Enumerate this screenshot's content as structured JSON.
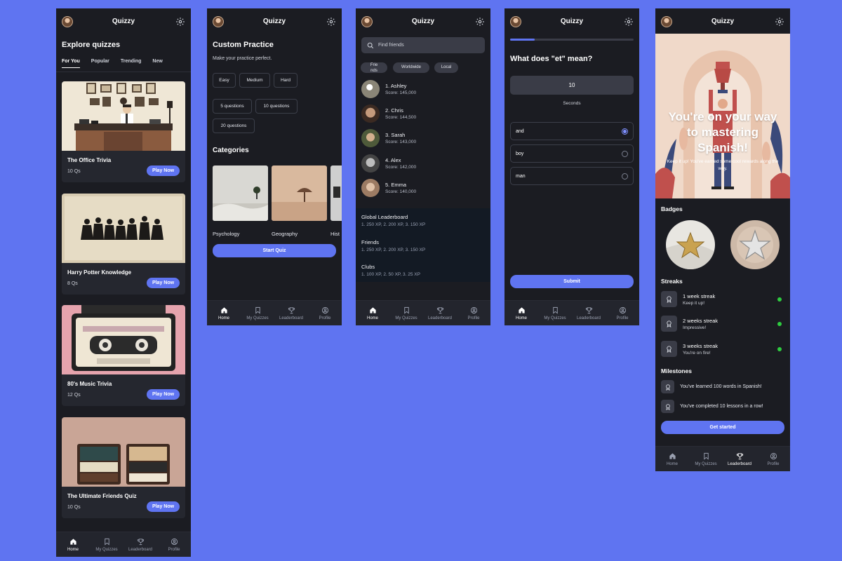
{
  "app": {
    "title": "Quizzy"
  },
  "nav": [
    {
      "label": "Home",
      "icon": "home-icon"
    },
    {
      "label": "My Quizzes",
      "icon": "bookmark-icon"
    },
    {
      "label": "Leaderboard",
      "icon": "trophy-icon"
    },
    {
      "label": "Profile",
      "icon": "profile-icon"
    }
  ],
  "explore": {
    "heading": "Explore quizzes",
    "tabs": [
      "For You",
      "Popular",
      "Trending",
      "New"
    ],
    "quizzes": [
      {
        "title": "The Office Trivia",
        "count": "10 Qs",
        "cta": "Play Now"
      },
      {
        "title": "Harry Potter Knowledge",
        "count": "8 Qs",
        "cta": "Play Now"
      },
      {
        "title": "80's Music Trivia",
        "count": "12 Qs",
        "cta": "Play Now"
      },
      {
        "title": "The Ultimate Friends Quiz",
        "count": "10 Qs",
        "cta": "Play Now"
      }
    ]
  },
  "practice": {
    "heading": "Custom Practice",
    "subtitle": "Make your practice perfect.",
    "difficulty": [
      "Easy",
      "Medium",
      "Hard"
    ],
    "lengths": [
      "5 questions",
      "10 questions",
      "20 questions"
    ],
    "categories_heading": "Categories",
    "categories": [
      "Psychology",
      "Geography",
      "Hist"
    ],
    "start": "Start Quiz"
  },
  "friends": {
    "search_placeholder": "Find friends",
    "filters": [
      "Frie\nnds",
      "Worldwide",
      "Local"
    ],
    "list": [
      {
        "name": "1. Ashley",
        "score": "Score: 145,000"
      },
      {
        "name": "2. Chris",
        "score": "Score: 144,500"
      },
      {
        "name": "3. Sarah",
        "score": "Score: 143,000"
      },
      {
        "name": "4. Alex",
        "score": "Score: 142,000"
      },
      {
        "name": "5. Emma",
        "score": "Score: 140,000"
      }
    ],
    "boards": [
      {
        "title": "Global Leaderboard",
        "values": "1. 250 XP, 2. 200 XP, 3. 150 XP"
      },
      {
        "title": "Friends",
        "values": "1. 250 XP, 2. 200 XP, 3. 150 XP"
      },
      {
        "title": "Clubs",
        "values": "1. 100 XP, 2. 50 XP, 3. 25 XP"
      }
    ]
  },
  "question": {
    "progress": 0.2,
    "text": "What does \"et\" mean?",
    "timer": "10",
    "timer_unit": "Seconds",
    "options": [
      {
        "label": "and",
        "selected": true
      },
      {
        "label": "boy",
        "selected": false
      },
      {
        "label": "man",
        "selected": false
      }
    ],
    "submit": "Submit"
  },
  "progress_screen": {
    "hero_title": "You're on your way to mastering Spanish!",
    "hero_sub": "Keep it up! You've earned some cool rewards along the way.",
    "badges_heading": "Badges",
    "streaks_heading": "Streaks",
    "streaks": [
      {
        "title": "1 week streak",
        "sub": "Keep it up!"
      },
      {
        "title": "2 weeks streak",
        "sub": "Impressive!"
      },
      {
        "title": "3 weeks streak",
        "sub": "You're on fire!"
      }
    ],
    "milestones_heading": "Milestones",
    "milestones": [
      "You've learned 100 words in Spanish!",
      "You've completed 10 lessons in a row!"
    ],
    "cta": "Get started"
  },
  "colors": {
    "accent": "#5f74f1",
    "background": "#5f74f1",
    "surface": "#1b1c22",
    "success": "#2ecc40"
  }
}
